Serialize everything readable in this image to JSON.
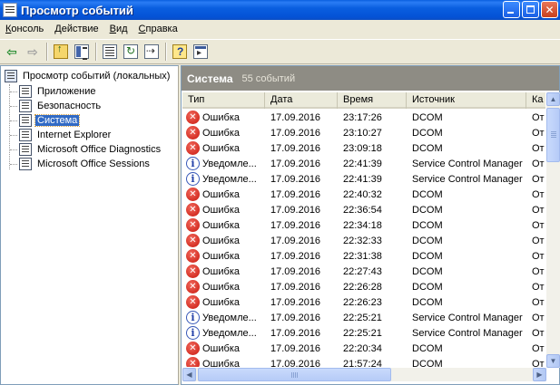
{
  "window": {
    "title": "Просмотр событий"
  },
  "menu": [
    {
      "label": "Консоль",
      "accel": "К",
      "rest": "онсоль"
    },
    {
      "label": "Действие",
      "accel": "Д",
      "rest": "ействие"
    },
    {
      "label": "Вид",
      "accel": "В",
      "rest": "ид"
    },
    {
      "label": "Справка",
      "accel": "С",
      "rest": "правка"
    }
  ],
  "tree": {
    "root": "Просмотр событий (локальных)",
    "items": [
      {
        "label": "Приложение",
        "selected": false
      },
      {
        "label": "Безопасность",
        "selected": false
      },
      {
        "label": "Система",
        "selected": true
      },
      {
        "label": "Internet Explorer",
        "selected": false
      },
      {
        "label": "Microsoft Office Diagnostics",
        "selected": false
      },
      {
        "label": "Microsoft Office Sessions",
        "selected": false
      }
    ]
  },
  "panel": {
    "title": "Система",
    "count": "55 событий"
  },
  "columns": [
    "Тип",
    "Дата",
    "Время",
    "Источник",
    "Ка"
  ],
  "events": [
    {
      "icon": "error-icon",
      "type": "Ошибка",
      "date": "17.09.2016",
      "time": "23:17:26",
      "source": "DCOM",
      "category": "От"
    },
    {
      "icon": "error-icon",
      "type": "Ошибка",
      "date": "17.09.2016",
      "time": "23:10:27",
      "source": "DCOM",
      "category": "От"
    },
    {
      "icon": "error-icon",
      "type": "Ошибка",
      "date": "17.09.2016",
      "time": "23:09:18",
      "source": "DCOM",
      "category": "От"
    },
    {
      "icon": "info-icon",
      "type": "Уведомле...",
      "date": "17.09.2016",
      "time": "22:41:39",
      "source": "Service Control Manager",
      "category": "От"
    },
    {
      "icon": "info-icon",
      "type": "Уведомле...",
      "date": "17.09.2016",
      "time": "22:41:39",
      "source": "Service Control Manager",
      "category": "От"
    },
    {
      "icon": "error-icon",
      "type": "Ошибка",
      "date": "17.09.2016",
      "time": "22:40:32",
      "source": "DCOM",
      "category": "От"
    },
    {
      "icon": "error-icon",
      "type": "Ошибка",
      "date": "17.09.2016",
      "time": "22:36:54",
      "source": "DCOM",
      "category": "От"
    },
    {
      "icon": "error-icon",
      "type": "Ошибка",
      "date": "17.09.2016",
      "time": "22:34:18",
      "source": "DCOM",
      "category": "От"
    },
    {
      "icon": "error-icon",
      "type": "Ошибка",
      "date": "17.09.2016",
      "time": "22:32:33",
      "source": "DCOM",
      "category": "От"
    },
    {
      "icon": "error-icon",
      "type": "Ошибка",
      "date": "17.09.2016",
      "time": "22:31:38",
      "source": "DCOM",
      "category": "От"
    },
    {
      "icon": "error-icon",
      "type": "Ошибка",
      "date": "17.09.2016",
      "time": "22:27:43",
      "source": "DCOM",
      "category": "От"
    },
    {
      "icon": "error-icon",
      "type": "Ошибка",
      "date": "17.09.2016",
      "time": "22:26:28",
      "source": "DCOM",
      "category": "От"
    },
    {
      "icon": "error-icon",
      "type": "Ошибка",
      "date": "17.09.2016",
      "time": "22:26:23",
      "source": "DCOM",
      "category": "От"
    },
    {
      "icon": "info-icon",
      "type": "Уведомле...",
      "date": "17.09.2016",
      "time": "22:25:21",
      "source": "Service Control Manager",
      "category": "От"
    },
    {
      "icon": "info-icon",
      "type": "Уведомле...",
      "date": "17.09.2016",
      "time": "22:25:21",
      "source": "Service Control Manager",
      "category": "От"
    },
    {
      "icon": "error-icon",
      "type": "Ошибка",
      "date": "17.09.2016",
      "time": "22:20:34",
      "source": "DCOM",
      "category": "От"
    },
    {
      "icon": "error-icon",
      "type": "Ошибка",
      "date": "17.09.2016",
      "time": "21:57:24",
      "source": "DCOM",
      "category": "От"
    }
  ],
  "toolbar_icons": [
    "back-arrow-icon",
    "forward-arrow-icon",
    "up-folder-icon",
    "show-hide-tree-icon",
    "properties-icon",
    "refresh-icon",
    "export-list-icon",
    "help-icon",
    "new-window-icon"
  ]
}
